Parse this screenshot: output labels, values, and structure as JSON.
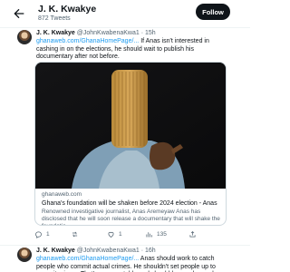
{
  "profile": {
    "name": "J. K. Kwakye",
    "tweet_count": "872 Tweets",
    "follow_label": "Follow"
  },
  "tweets": [
    {
      "author": "J. K. Kwakye",
      "handle": "@JohnKwabenaKwa1",
      "time": "· 15h",
      "link": "ghanaweb.com/GhanaHomePage/...",
      "text": " If Anas isn't interested in cashing in on the elections, he should wait to publish his documentary after not before.",
      "card": {
        "domain": "ghanaweb.com",
        "title": "Ghana's foundation will be shaken before 2024 election - Anas",
        "description": "Renowned investigative journalist, Anas Aremeyaw Anas has disclosed that he will soon release a documentary that will shake the foundatio..."
      },
      "actions": {
        "replies": "1",
        "retweets": "",
        "likes": "1",
        "views": "135"
      }
    },
    {
      "author": "J. K. Kwakye",
      "handle": "@JohnKwabenaKwa1",
      "time": "· 16h",
      "link": "ghanaweb.com/GhanaHomePage/...",
      "text": " Anas should work to catch people who commit actual crimes. He shouldn't set people up to commit crimes. That's unacceptable and should be condemned."
    }
  ],
  "colors": {
    "accent": "#1d9bf0",
    "text": "#0f1419",
    "muted": "#536471",
    "follow_bg": "#0f1419"
  }
}
